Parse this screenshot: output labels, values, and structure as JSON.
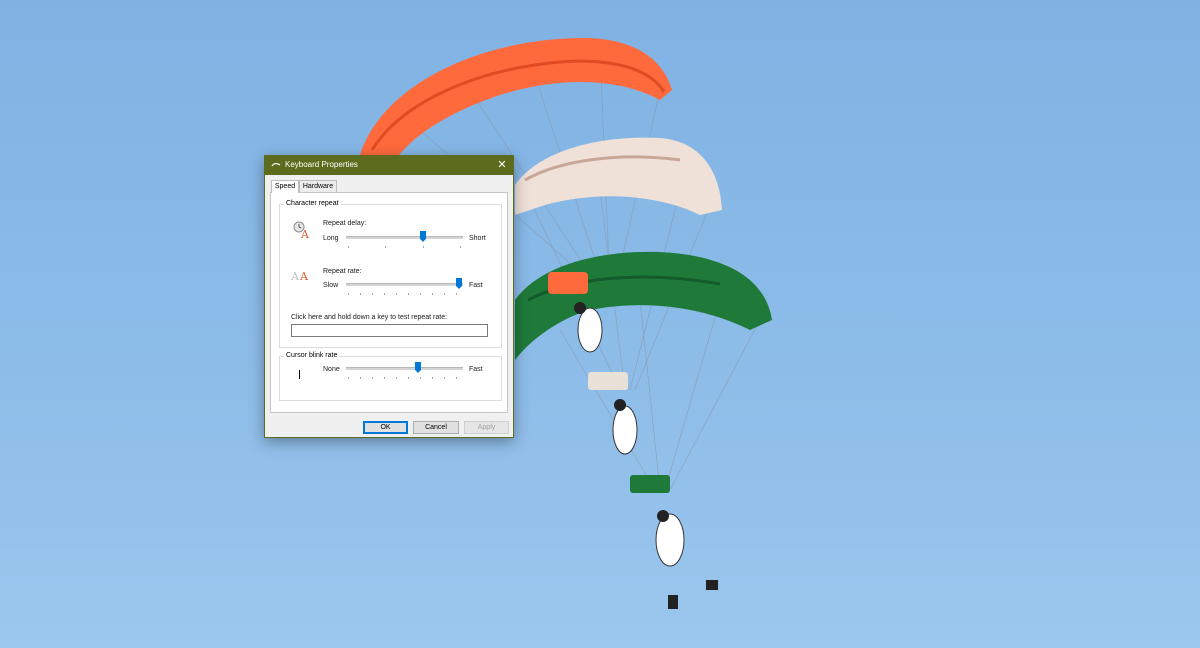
{
  "window": {
    "title": "Keyboard Properties",
    "close_glyph": "✕"
  },
  "tabs": [
    {
      "label": "Speed",
      "active": true
    },
    {
      "label": "Hardware",
      "active": false
    }
  ],
  "character_repeat": {
    "group_label": "Character repeat",
    "repeat_delay": {
      "label": "Repeat delay:",
      "min_label": "Long",
      "max_label": "Short",
      "value_fraction": 0.67,
      "icon": "repeat-delay-icon"
    },
    "repeat_rate": {
      "label": "Repeat rate:",
      "min_label": "Slow",
      "max_label": "Fast",
      "value_fraction": 1.0,
      "icon": "repeat-rate-icon"
    },
    "test_label": "Click here and hold down a key to test repeat rate:",
    "test_value": ""
  },
  "cursor_blink": {
    "group_label": "Cursor blink rate",
    "min_label": "None",
    "max_label": "Fast",
    "value_fraction": 0.62,
    "icon": "cursor-icon"
  },
  "buttons": {
    "ok": "OK",
    "cancel": "Cancel",
    "apply": "Apply"
  },
  "colors": {
    "titlebar": "#5d6b1e",
    "accent": "#0078d7",
    "sky": "#8ebde9"
  }
}
